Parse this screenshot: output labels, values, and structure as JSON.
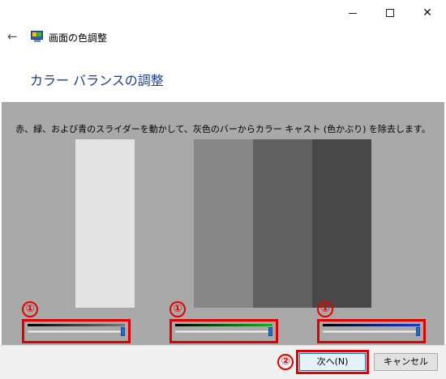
{
  "window": {
    "controls": {
      "minimize_icon": "minimize-icon",
      "maximize_icon": "maximize-icon",
      "close_icon": "close-icon"
    }
  },
  "nav": {
    "back_icon": "back-arrow-icon",
    "app_icon": "display-color-calibration-icon",
    "title": "画面の色調整"
  },
  "page": {
    "heading": "カラー バランスの調整",
    "instruction": "赤、緑、および青のスライダーを動かして、灰色のバーからカラー キャスト (色かぶり) を除去します。"
  },
  "gray_bars": [
    {
      "color": "#e3e3e3"
    },
    {
      "color": "#a8a8a8"
    },
    {
      "color": "#878787"
    },
    {
      "color": "#616161"
    },
    {
      "color": "#484848"
    }
  ],
  "sliders": [
    {
      "name": "red",
      "gradient_end": "#777777",
      "value": 1.0
    },
    {
      "name": "green",
      "gradient_end": "#17b51b",
      "value": 1.0
    },
    {
      "name": "blue",
      "gradient_end": "#1a3ad6",
      "value": 1.0
    }
  ],
  "annotations": {
    "marker_1": "①",
    "marker_2": "②",
    "highlight_color": "#e00000"
  },
  "buttons": {
    "next": "次へ(N)",
    "cancel": "キャンセル"
  }
}
